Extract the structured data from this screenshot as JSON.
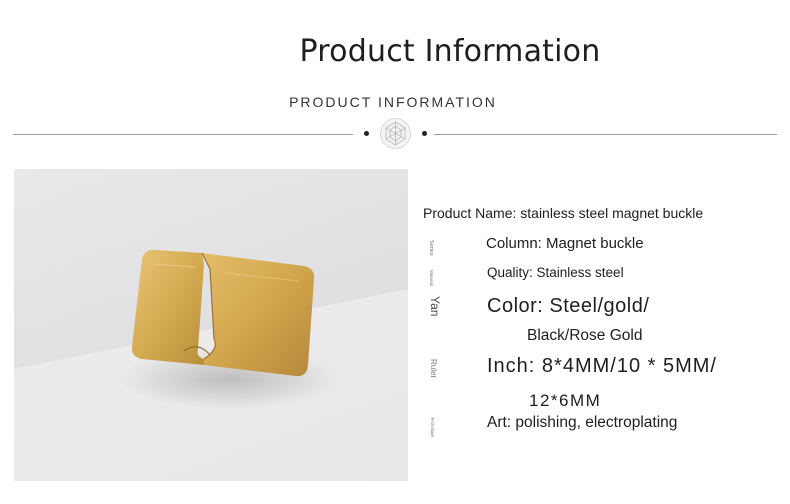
{
  "header": {
    "title": "Product Information",
    "subtitle": "PRODUCT INFORMATION"
  },
  "icons": {
    "ornament": "diamond-ornament-icon"
  },
  "colors": {
    "gold": "#d6ab4a",
    "rule": "#9a9a9a",
    "background": "#ffffff"
  },
  "specs": {
    "product_name": "Product Name: stainless steel magnet buckle",
    "column": "Column: Magnet buckle",
    "quality": "Quality: Stainless steel",
    "color_line1": "Color: Steel/gold/",
    "color_line2": "Black/Rose Gold",
    "inch_line1": "Inch: 8*4MM/10 * 5MM/",
    "inch_line2": "12*6MM",
    "art": "Art: polishing, electroplating"
  },
  "side_labels": {
    "series": "Series",
    "material": "Material",
    "yan": "Yan",
    "ruler": "Ruler",
    "technique": "Technique"
  }
}
